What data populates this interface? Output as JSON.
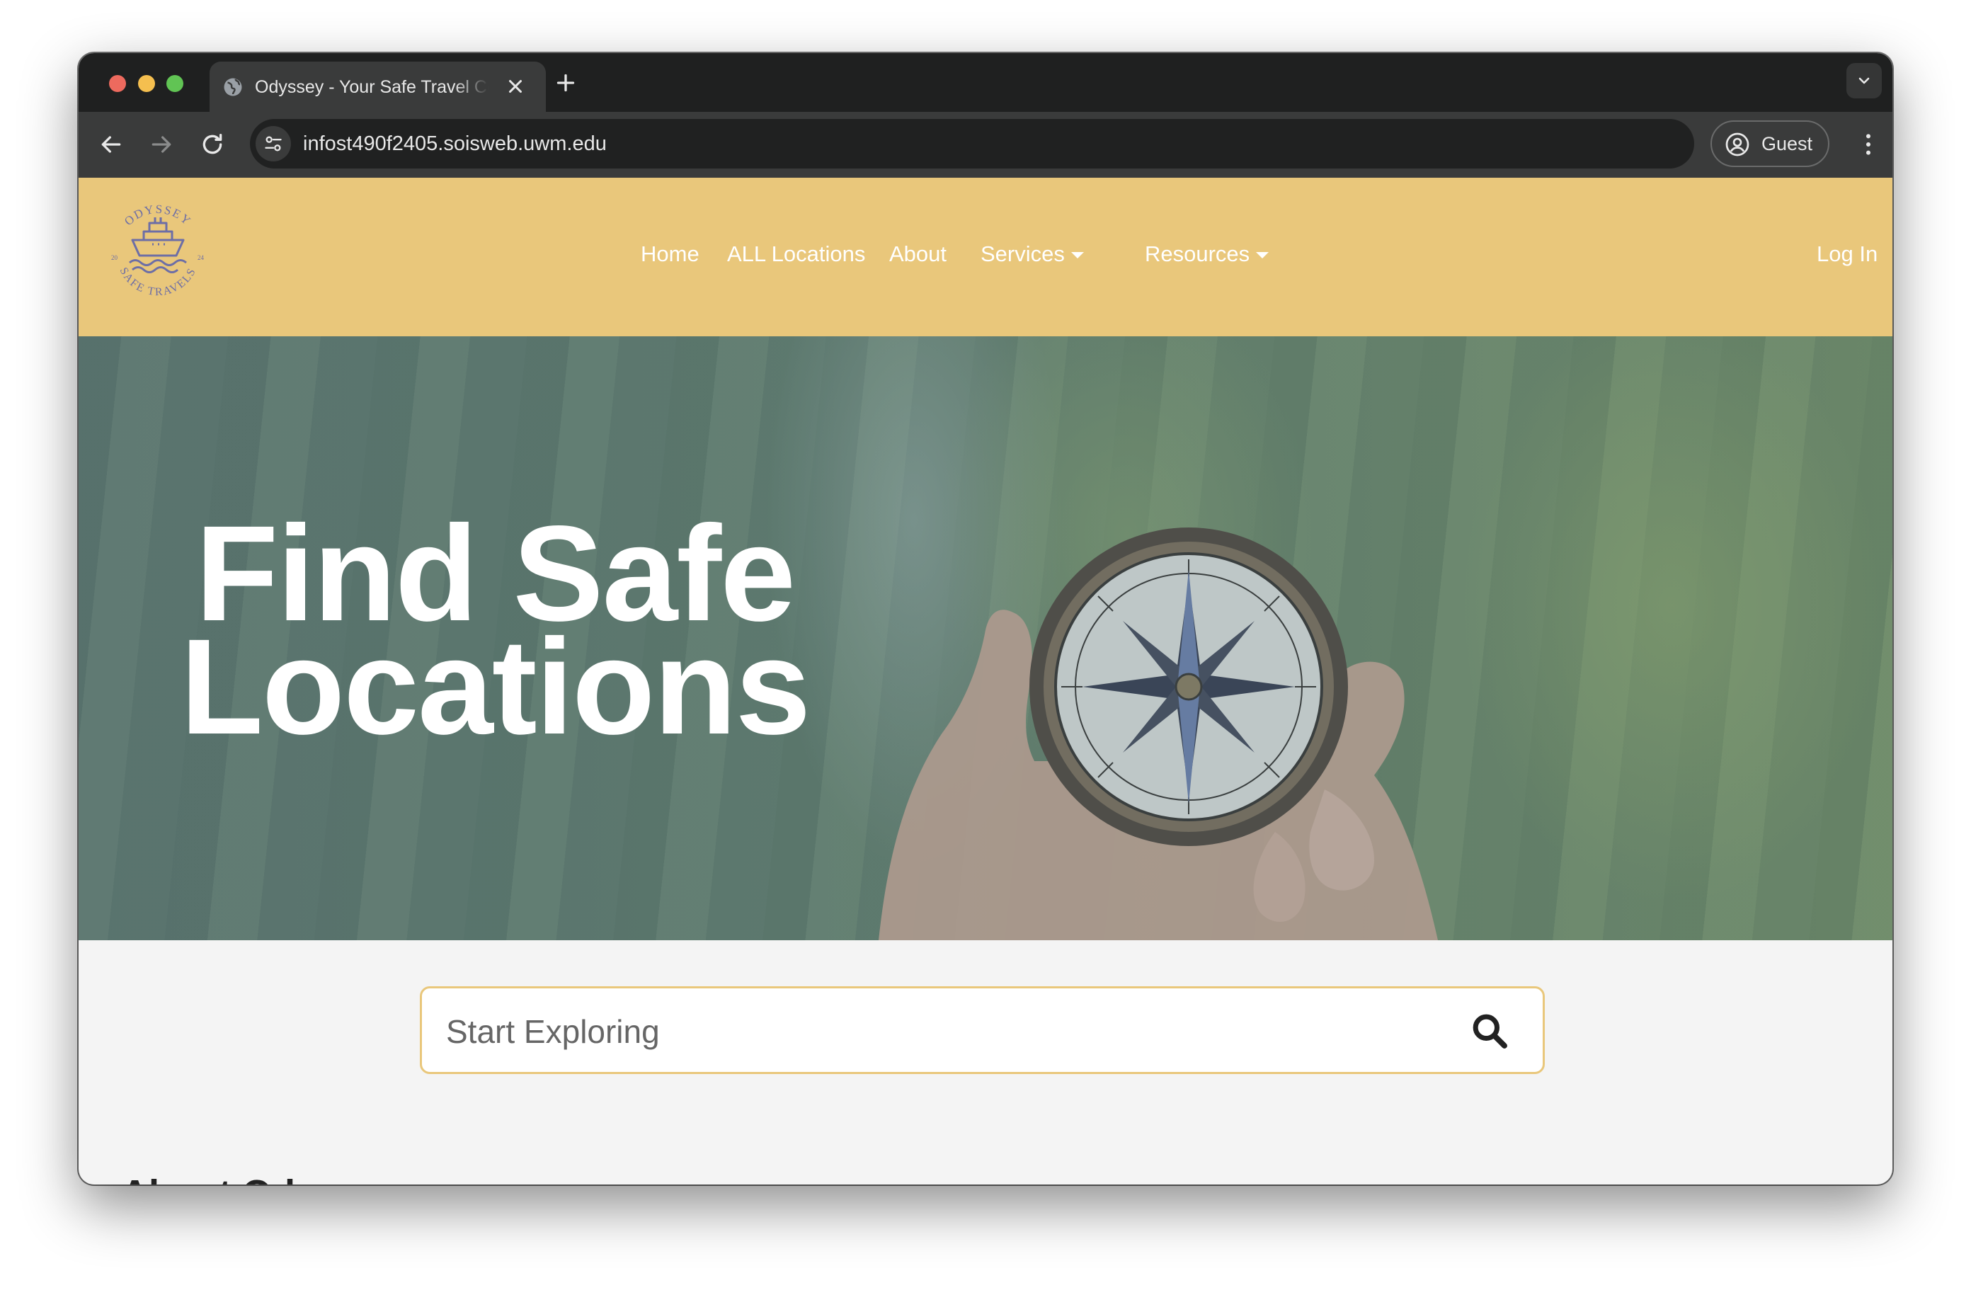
{
  "browser": {
    "tab_title": "Odyssey - Your Safe Travel Companion",
    "url": "infost490f2405.soisweb.uwm.edu",
    "profile_label": "Guest"
  },
  "site": {
    "logo_top_text": "ODYSSEY",
    "logo_bottom_text": "SAFE TRAVELS",
    "logo_left_year": "20",
    "logo_right_year": "24",
    "nav": [
      {
        "label": "Home"
      },
      {
        "label": "ALL Locations"
      },
      {
        "label": "About"
      },
      {
        "label": "Services",
        "dropdown": true
      },
      {
        "label": "Resources",
        "dropdown": true
      },
      {
        "label": "Log In"
      }
    ],
    "colors": {
      "header": "#e9c77b",
      "nav_text": "#ffffff",
      "page_bg": "#f4f4f4"
    }
  },
  "hero": {
    "title_line1": "Find Safe",
    "title_line2": "Locations"
  },
  "search": {
    "placeholder": "Start Exploring"
  },
  "section_peek": {
    "heading": "About Odyssey"
  }
}
